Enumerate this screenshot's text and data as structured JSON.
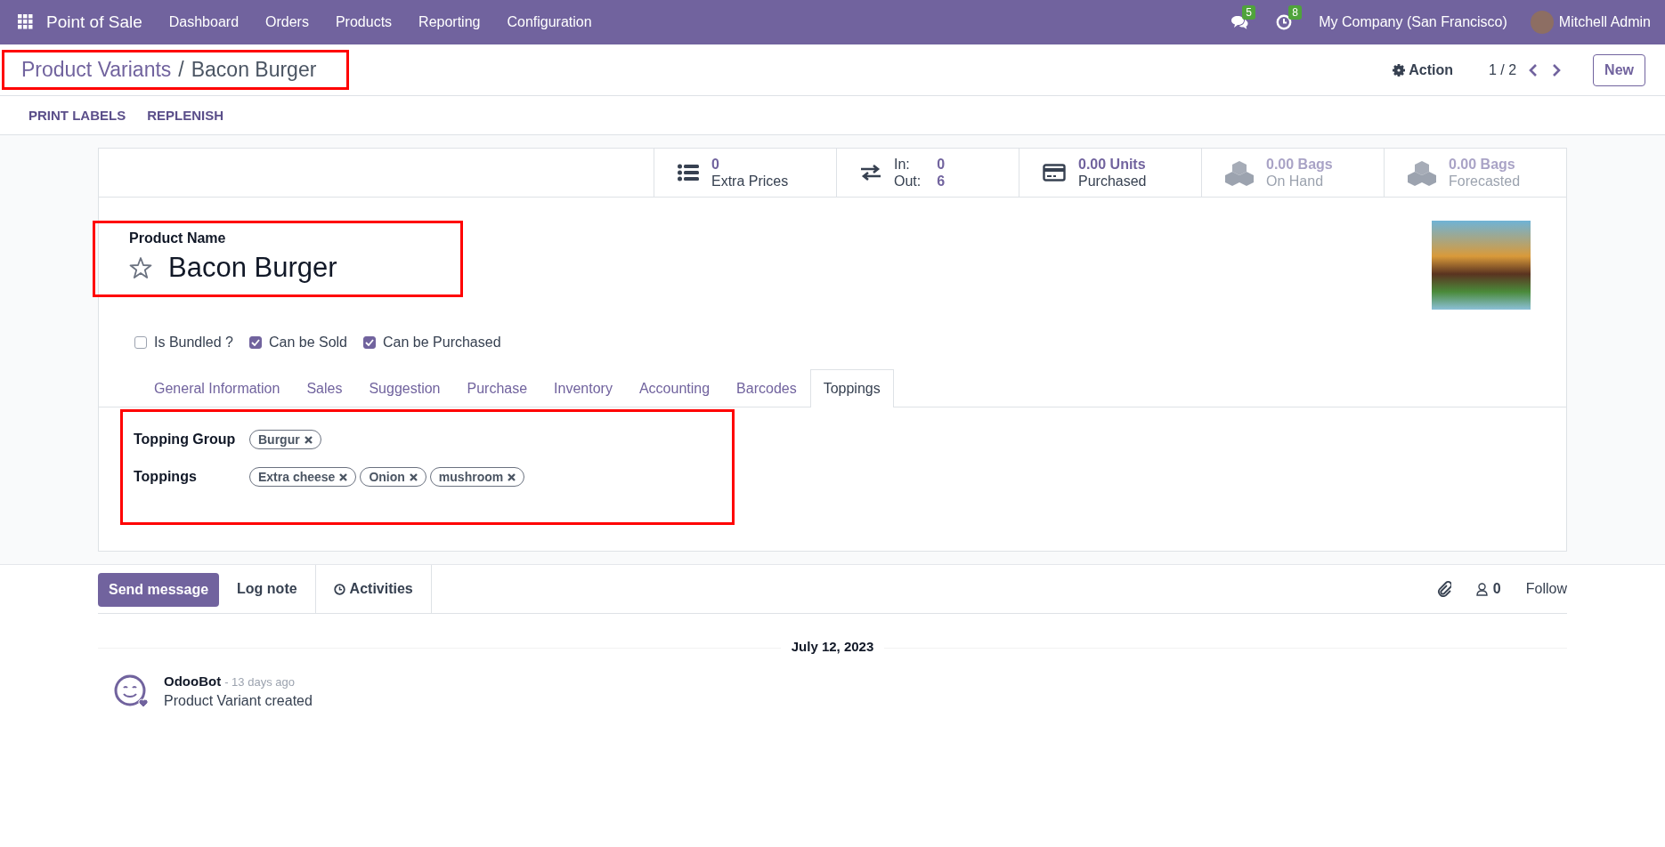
{
  "navbar": {
    "app_name": "Point of Sale",
    "menu": [
      "Dashboard",
      "Orders",
      "Products",
      "Reporting",
      "Configuration"
    ],
    "messages_count": "5",
    "activities_count": "8",
    "company": "My Company (San Francisco)",
    "user": "Mitchell Admin"
  },
  "control_panel": {
    "breadcrumb": [
      {
        "label": "Product Variants"
      },
      {
        "label": "Bacon Burger"
      }
    ],
    "separator": "/",
    "highlighted": true,
    "action": "Action",
    "pager": "1 / 2",
    "new_button": "New",
    "buttons": [
      "PRINT LABELS",
      "REPLENISH"
    ]
  },
  "stat_buttons": [
    {
      "kind": "list",
      "value": "0",
      "label": "Extra Prices",
      "disabled": false
    },
    {
      "kind": "in_out",
      "in_label": "In:",
      "in_value": "0",
      "out_label": "Out:",
      "out_value": "6",
      "disabled": false
    },
    {
      "kind": "card",
      "value": "0.00 Units",
      "label": "Purchased",
      "disabled": false
    },
    {
      "kind": "cubes",
      "value": "0.00 Bags",
      "label": "On Hand",
      "disabled": true
    },
    {
      "kind": "cubes",
      "value": "0.00 Bags",
      "label": "Forecasted",
      "disabled": true
    }
  ],
  "product": {
    "label": "Product Name",
    "name": "Bacon Burger",
    "favorite": false,
    "highlighted": true
  },
  "checkboxes": [
    {
      "label": "Is Bundled ?",
      "checked": false
    },
    {
      "label": "Can be Sold",
      "checked": true
    },
    {
      "label": "Can be Purchased",
      "checked": true
    }
  ],
  "tabs": [
    {
      "label": "General Information",
      "selected": false
    },
    {
      "label": "Sales",
      "selected": false
    },
    {
      "label": "Suggestion",
      "selected": false
    },
    {
      "label": "Purchase",
      "selected": false
    },
    {
      "label": "Inventory",
      "selected": false
    },
    {
      "label": "Accounting",
      "selected": false
    },
    {
      "label": "Barcodes",
      "selected": false
    },
    {
      "label": "Toppings",
      "selected": true
    }
  ],
  "toppings_panel": {
    "highlighted": true,
    "fields": [
      {
        "label": "Topping Group",
        "tags": [
          "Burgur"
        ]
      },
      {
        "label": "Toppings",
        "tags": [
          "Extra cheese",
          "Onion",
          "mushroom"
        ]
      }
    ]
  },
  "chatter": {
    "buttons": [
      {
        "label": "Send message",
        "selected": true
      },
      {
        "label": "Log note",
        "selected": false
      },
      {
        "label": "Activities",
        "selected": false
      }
    ],
    "followers": "0",
    "follow": "Follow",
    "date": "July 12, 2023",
    "messages": [
      {
        "author": "OdooBot",
        "time": "- 13 days ago",
        "body": "Product Variant created"
      }
    ]
  }
}
